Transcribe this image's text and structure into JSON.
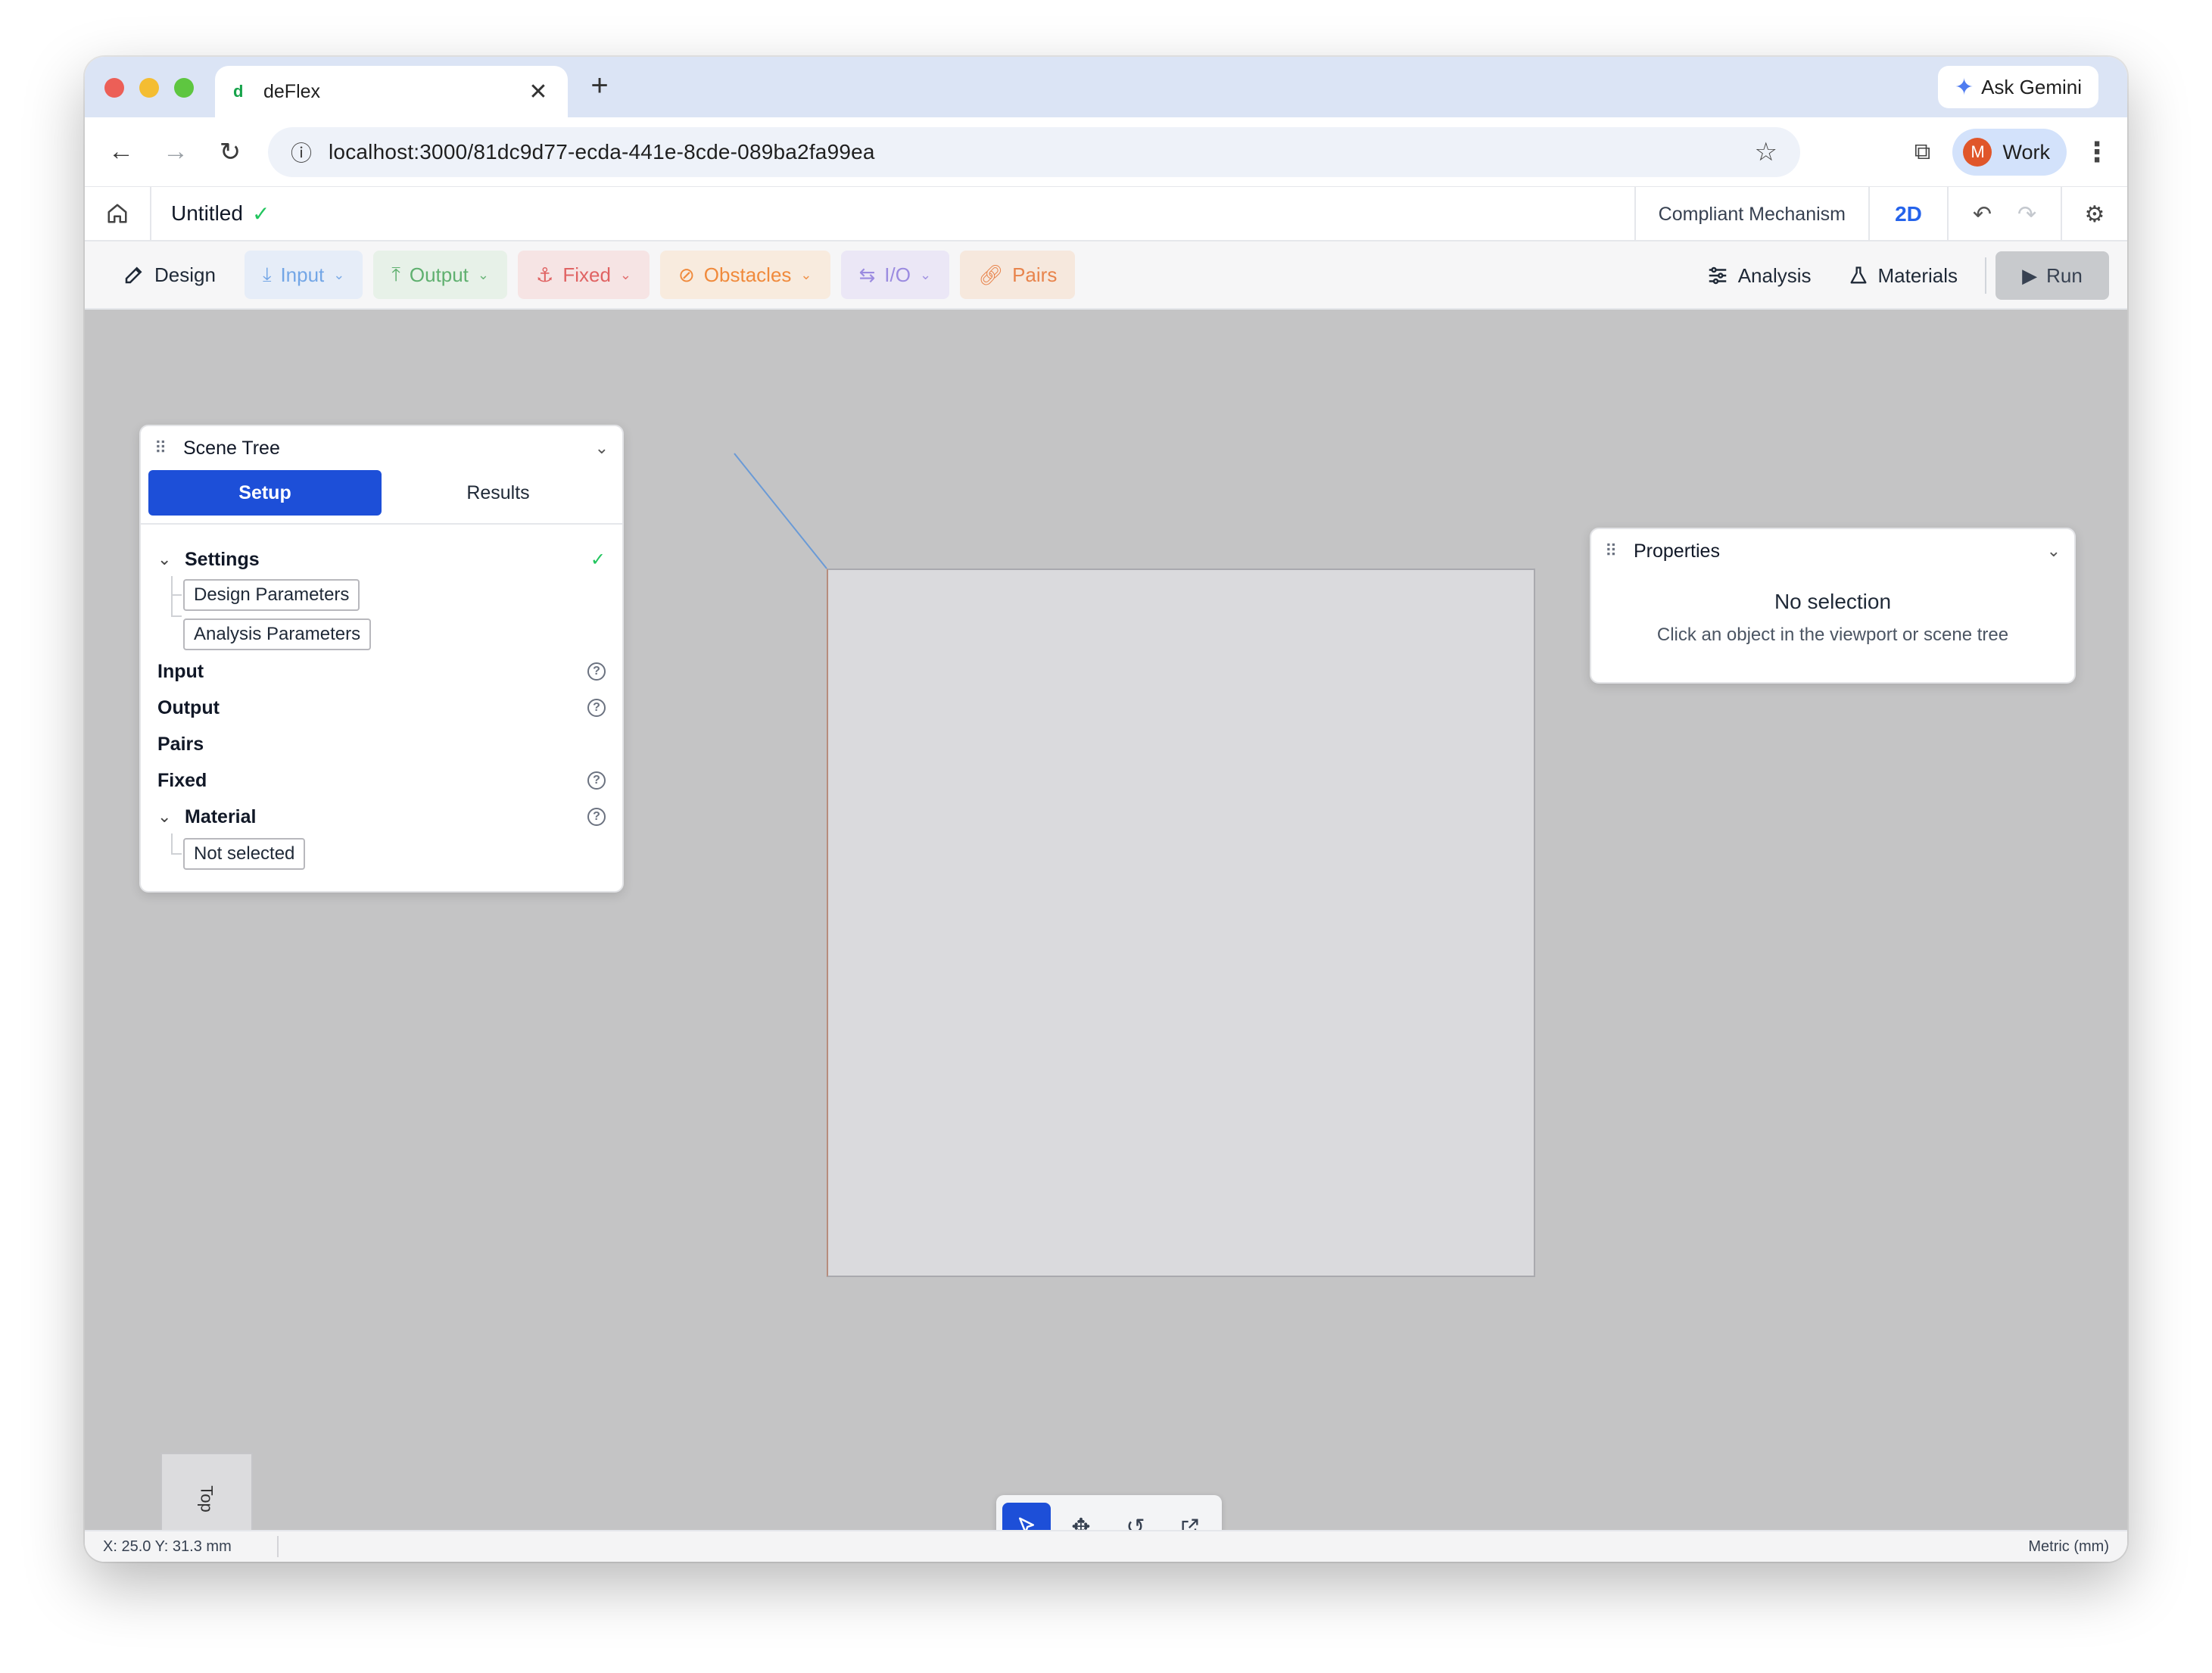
{
  "browser": {
    "tab_favicon": "d",
    "tab_title": "deFlex",
    "tab_close": "✕",
    "new_tab": "+",
    "gemini_label": "Ask Gemini",
    "url": "localhost:3000/81dc9d77-ecda-441e-8cde-089ba2fa99ea",
    "profile_initial": "M",
    "profile_label": "Work"
  },
  "app": {
    "doc_title": "Untitled",
    "mode": "Compliant Mechanism",
    "view_mode": "2D"
  },
  "toolbar": {
    "design": "Design",
    "input": "Input",
    "output": "Output",
    "fixed": "Fixed",
    "obstacles": "Obstacles",
    "io": "I/O",
    "pairs": "Pairs",
    "analysis": "Analysis",
    "materials": "Materials",
    "run": "Run"
  },
  "scene_tree": {
    "title": "Scene Tree",
    "tab_setup": "Setup",
    "tab_results": "Results",
    "settings": "Settings",
    "design_parameters": "Design Parameters",
    "analysis_parameters": "Analysis Parameters",
    "input": "Input",
    "output": "Output",
    "pairs": "Pairs",
    "fixed": "Fixed",
    "material": "Material",
    "material_value": "Not selected"
  },
  "properties": {
    "title": "Properties",
    "empty_title": "No selection",
    "empty_hint": "Click an object in the viewport or scene tree"
  },
  "viewport": {
    "view_cube_label": "Top"
  },
  "status": {
    "coords": "X: 25.0 Y: 31.3 mm",
    "units": "Metric (mm)"
  },
  "colors": {
    "accent": "#1d4fd8",
    "input": "#73a6e6",
    "output": "#5fb06f",
    "fixed": "#e06363",
    "obstacles": "#f08a3c",
    "io": "#9b8be0",
    "pairs": "#e8844c"
  }
}
